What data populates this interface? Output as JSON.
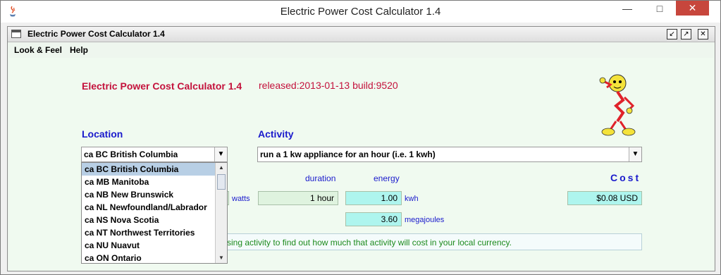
{
  "os_window": {
    "title": "Electric Power Cost Calculator 1.4"
  },
  "internal_frame": {
    "title": "Electric Power Cost Calculator 1.4"
  },
  "menu": {
    "items": [
      "Look & Feel",
      "Help"
    ]
  },
  "header": {
    "app_title": "Electric Power Cost Calculator 1.4",
    "release": "released:2013-01-13 build:9520"
  },
  "location": {
    "label": "Location",
    "selected": "ca BC British Columbia",
    "options": [
      "ca BC British Columbia",
      "ca MB Manitoba",
      "ca NB New Brunswick",
      "ca NL Newfoundland/Labrador",
      "ca NS Nova Scotia",
      "ca NT Northwest Territories",
      "ca NU Nuavut",
      "ca ON Ontario"
    ]
  },
  "activity": {
    "label": "Activity",
    "selected": "run a 1 kw appliance for an hour (i.e. 1 kwh)"
  },
  "columns": {
    "duration": "duration",
    "energy": "energy",
    "cost": "Cost"
  },
  "values": {
    "duration": "1 hour",
    "energy_kwh": "1.00",
    "energy_mj": "3.60",
    "cost": "$0.08 USD"
  },
  "units": {
    "watts": "watts",
    "kwh": "kwh",
    "mj": "megajoules"
  },
  "hint": "sing activity to find out how much that activity will cost in your local currency.",
  "colors": {
    "title_red": "#c4123c",
    "label_blue": "#1a1acc",
    "field_cyan": "#aef5ee",
    "hint_green": "#1c8a1c"
  }
}
